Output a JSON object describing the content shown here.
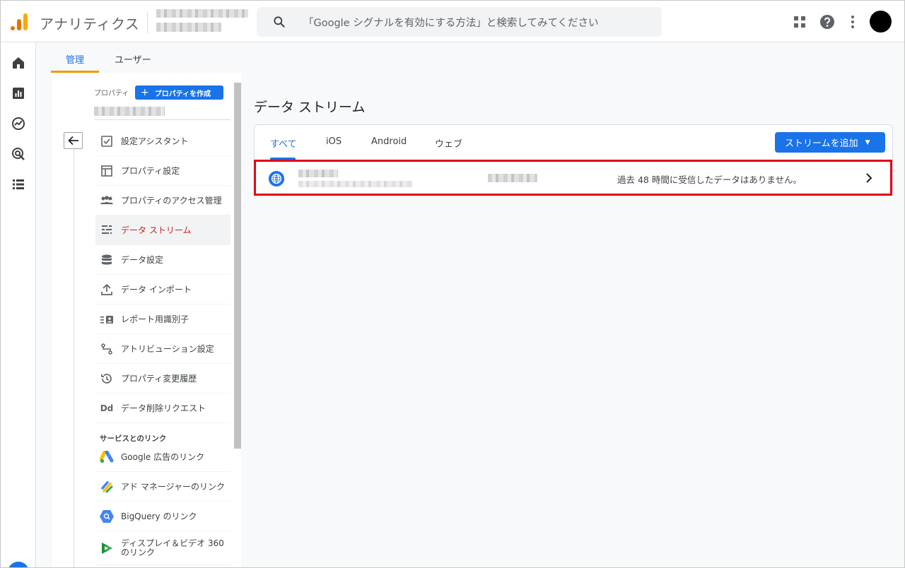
{
  "header": {
    "app_title": "アナリティクス",
    "search_placeholder": "「Google シグナルを有効にする方法」と検索してみてください"
  },
  "admin_tabs": [
    {
      "label": "管理",
      "active": true
    },
    {
      "label": "ユーザー",
      "active": false
    }
  ],
  "property": {
    "label": "プロパティ",
    "create_label": "プロパティを作成"
  },
  "menu": [
    {
      "label": "設定アシスタント",
      "icon": "checklist-icon"
    },
    {
      "label": "プロパティ設定",
      "icon": "property-settings-icon"
    },
    {
      "label": "プロパティのアクセス管理",
      "icon": "people-icon"
    },
    {
      "label": "データ ストリーム",
      "icon": "data-streams-icon",
      "active": true
    },
    {
      "label": "データ設定",
      "icon": "database-icon"
    },
    {
      "label": "データ インポート",
      "icon": "upload-icon"
    },
    {
      "label": "レポート用識別子",
      "icon": "identifier-icon"
    },
    {
      "label": "アトリビューション設定",
      "icon": "attribution-icon"
    },
    {
      "label": "プロパティ変更履歴",
      "icon": "history-icon"
    },
    {
      "label": "データ削除リクエスト",
      "icon": "dd-icon"
    }
  ],
  "links_section": {
    "title": "サービスとのリンク",
    "items": [
      {
        "label": "Google 広告のリンク",
        "icon": "google-ads-icon"
      },
      {
        "label": "アド マネージャーのリンク",
        "icon": "ad-manager-icon"
      },
      {
        "label": "BigQuery のリンク",
        "icon": "bigquery-icon"
      },
      {
        "label": "ディスプレイ＆ビデオ 360 のリンク",
        "line1": "ディスプレイ＆ビデオ 360",
        "line2": "のリンク",
        "icon": "dv360-icon"
      }
    ]
  },
  "main": {
    "title": "データ ストリーム",
    "tabs": [
      {
        "label": "すべて",
        "active": true
      },
      {
        "label": "iOS",
        "active": false
      },
      {
        "label": "Android",
        "active": false
      },
      {
        "label": "ウェブ",
        "active": false
      }
    ],
    "add_stream_label": "ストリームを追加",
    "stream_row": {
      "status": "過去 48 時間に受信したデータはありません。"
    }
  },
  "colors": {
    "accent": "#1a73e8",
    "orange": "#f29900",
    "highlight_border": "#e0001b",
    "active_menu_text": "#c5221f"
  }
}
